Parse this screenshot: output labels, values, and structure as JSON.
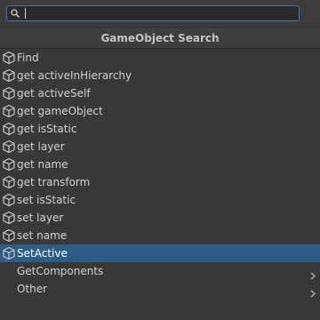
{
  "search": {
    "value": "",
    "icon": "search-icon"
  },
  "header": {
    "title": "GameObject Search"
  },
  "items": [
    {
      "label": "Find",
      "icon": "cube-icon"
    },
    {
      "label": "get activeInHierarchy",
      "icon": "cube-icon"
    },
    {
      "label": "get activeSelf",
      "icon": "cube-icon"
    },
    {
      "label": "get gameObject",
      "icon": "cube-icon"
    },
    {
      "label": "get isStatic",
      "icon": "cube-icon"
    },
    {
      "label": "get layer",
      "icon": "cube-icon"
    },
    {
      "label": "get name",
      "icon": "cube-icon"
    },
    {
      "label": "get transform",
      "icon": "cube-icon"
    },
    {
      "label": "set isStatic",
      "icon": "cube-icon"
    },
    {
      "label": "set layer",
      "icon": "cube-icon"
    },
    {
      "label": "set name",
      "icon": "cube-icon"
    },
    {
      "label": "SetActive",
      "icon": "cube-icon",
      "selected": true
    }
  ],
  "groups": [
    {
      "label": "GetComponents",
      "icon": "chevron-right-icon"
    },
    {
      "label": "Other",
      "icon": "chevron-right-icon"
    }
  ],
  "colors": {
    "background": "#383838",
    "selection": "#2c5d87",
    "search_border": "#3a79bb",
    "text": "#d2d2d2"
  }
}
